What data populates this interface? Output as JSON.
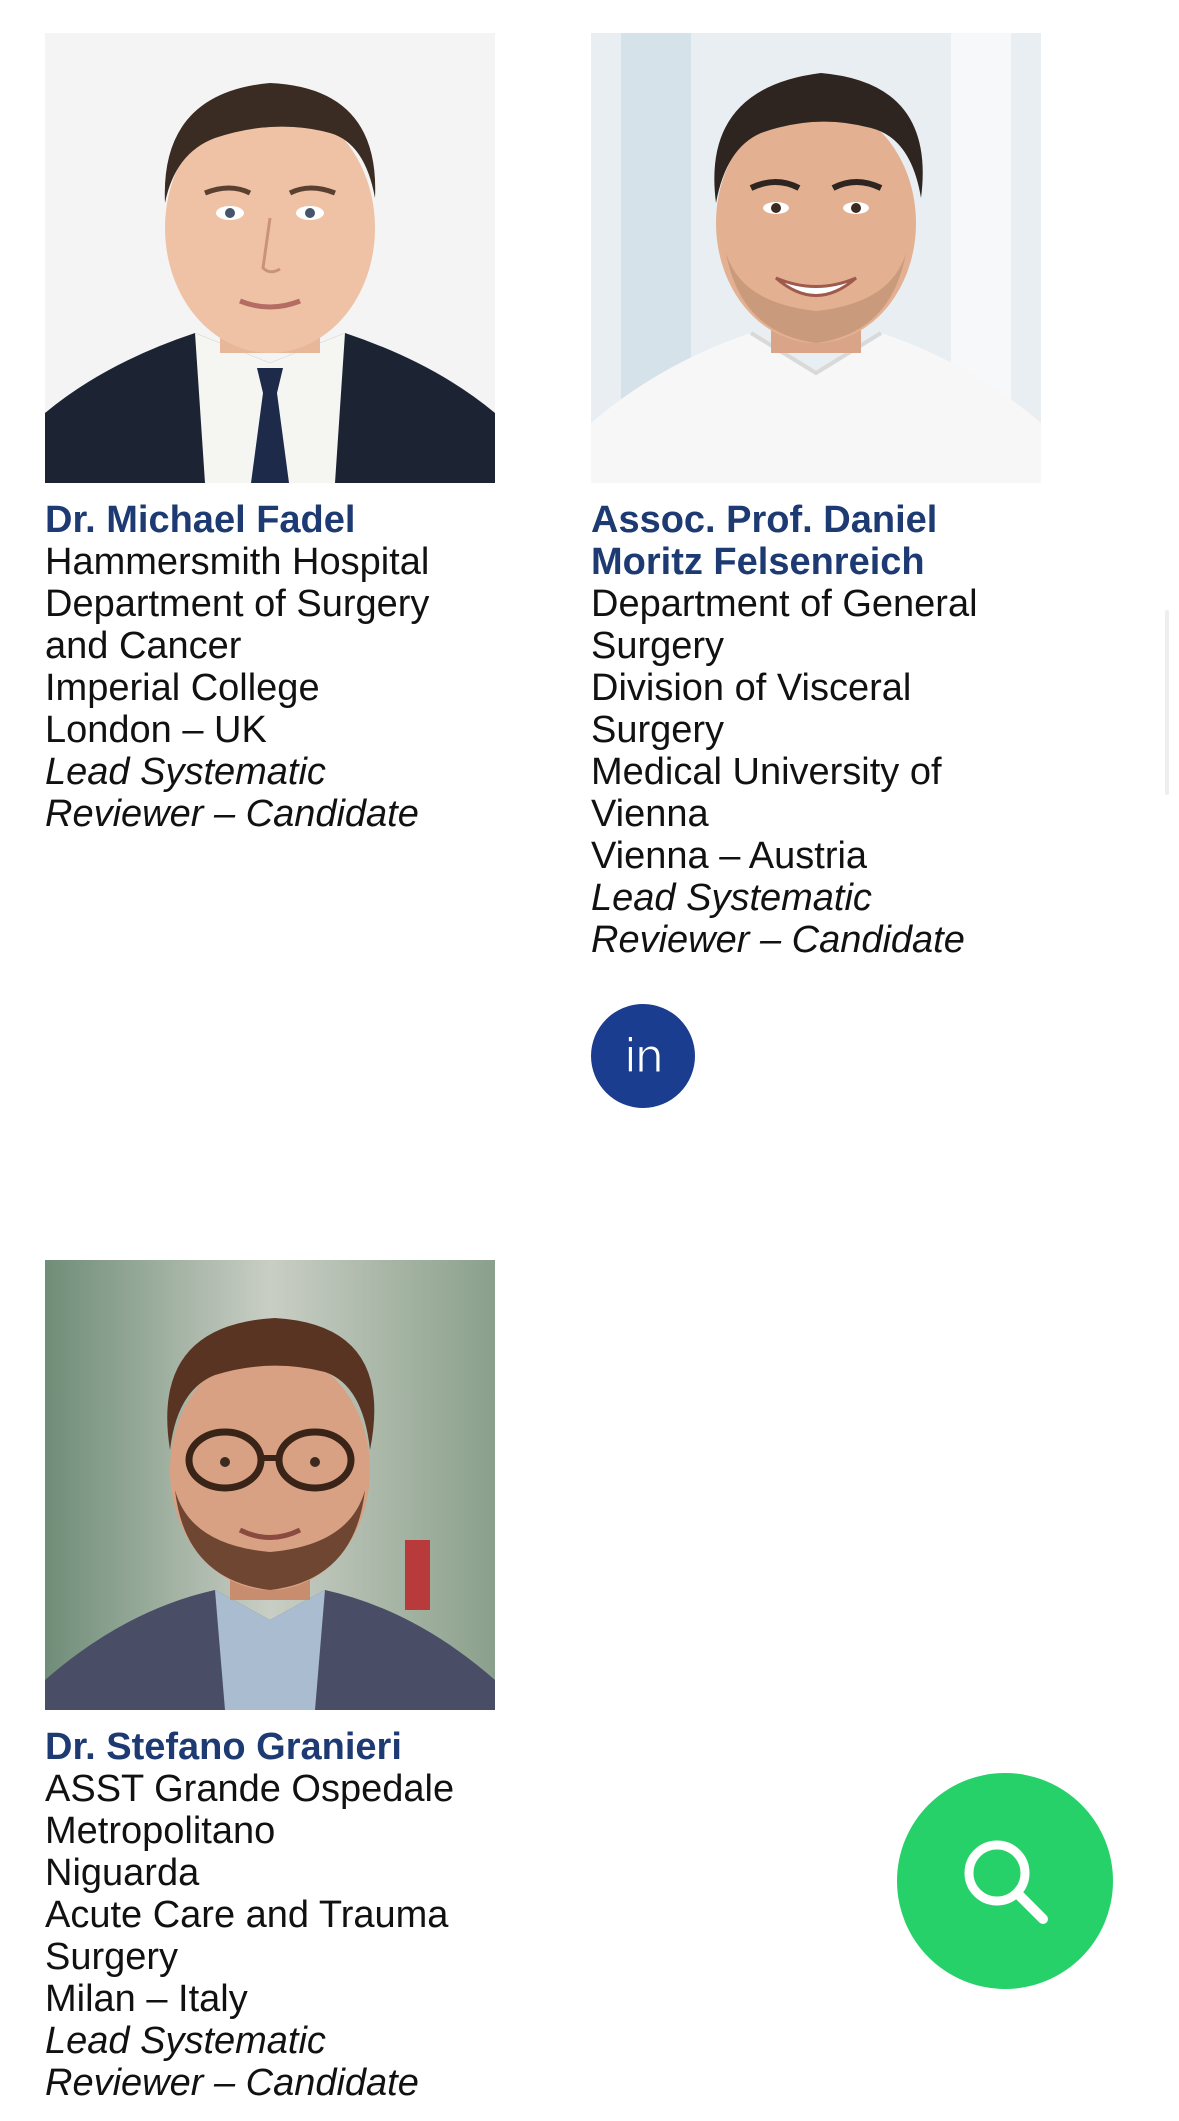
{
  "people": [
    {
      "name": "Dr. Michael Fadel",
      "lines": [
        "Hammersmith Hospital",
        "Department of Surgery",
        "and Cancer",
        "Imperial College",
        "London – UK"
      ],
      "role_lines": [
        "Lead Systematic",
        "Reviewer – Candidate"
      ]
    },
    {
      "name_lines": [
        "Assoc. Prof. Daniel",
        "Moritz Felsenreich"
      ],
      "lines": [
        "Department of General",
        "Surgery",
        "Division of Visceral",
        "Surgery",
        "Medical University of",
        "Vienna",
        "Vienna – Austria"
      ],
      "role_lines": [
        "Lead Systematic",
        "Reviewer – Candidate"
      ],
      "social_icon": "linkedin-icon"
    },
    {
      "name": "Dr. Stefano Granieri",
      "lines": [
        "ASST Grande Ospedale",
        "Metropolitano",
        "Niguarda",
        "Acute Care and Trauma",
        "Surgery",
        "Milan – Italy"
      ],
      "role_lines": [
        "Lead Systematic",
        "Reviewer – Candidate"
      ]
    }
  ],
  "linkedin_label": "in",
  "fab": {
    "icon": "search-icon"
  },
  "colors": {
    "name": "#1d3a73",
    "linkedin_bg": "#1b3d8f",
    "fab_bg": "#27d16a"
  }
}
